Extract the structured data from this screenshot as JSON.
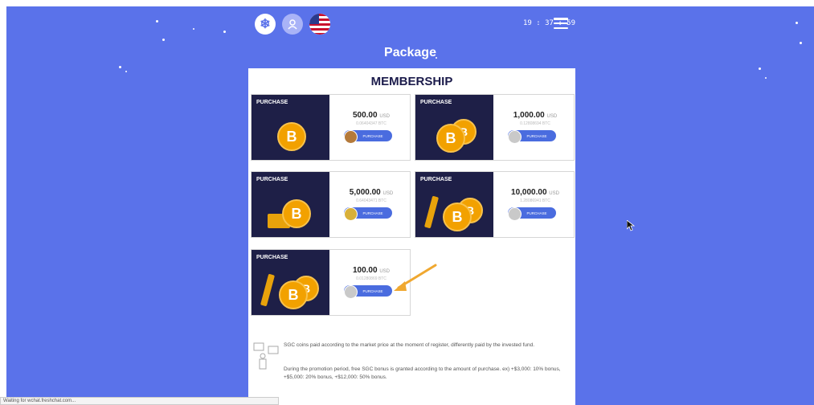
{
  "header": {
    "time": "19 : 37 : 59",
    "icons": [
      "snowflake-icon",
      "user-icon",
      "us-flag-icon",
      "hamburger-menu-icon"
    ]
  },
  "page": {
    "title": "Package",
    "panel_title": "MEMBERSHIP"
  },
  "packages": [
    {
      "tag": "PURCHASE",
      "price": "500.00",
      "unit": "USD",
      "btc": "0.06404347 BTC",
      "button": "PURCHASE"
    },
    {
      "tag": "PURCHASE",
      "price": "1,000.00",
      "unit": "USD",
      "btc": "0.12808694 BTC",
      "button": "PURCHASE"
    },
    {
      "tag": "PURCHASE",
      "price": "5,000.00",
      "unit": "USD",
      "btc": "0.64043471 BTC",
      "button": "PURCHASE"
    },
    {
      "tag": "PURCHASE",
      "price": "10,000.00",
      "unit": "USD",
      "btc": "1.28086941 BTC",
      "button": "PURCHASE"
    },
    {
      "tag": "PURCHASE",
      "price": "100.00",
      "unit": "USD",
      "btc": "0.01280869 BTC",
      "button": "PURCHASE"
    }
  ],
  "notes": {
    "line1": "SGC coins paid according to the market price at the moment of register, differently paid by the invested fund.",
    "line2": "During the promotion period, free SGC bonus is granted according to the amount of purchase. ex) +$3,000: 10% bonus, +$5,000: 20% bonus, +$12,000: 50% bonus."
  },
  "status_bar": "Waiting for wchat.freshchat.com...",
  "colors": {
    "background": "#5a72ea",
    "button": "#4a6cdf",
    "coin": "#f2a100",
    "card_image": "#1e1f47"
  }
}
